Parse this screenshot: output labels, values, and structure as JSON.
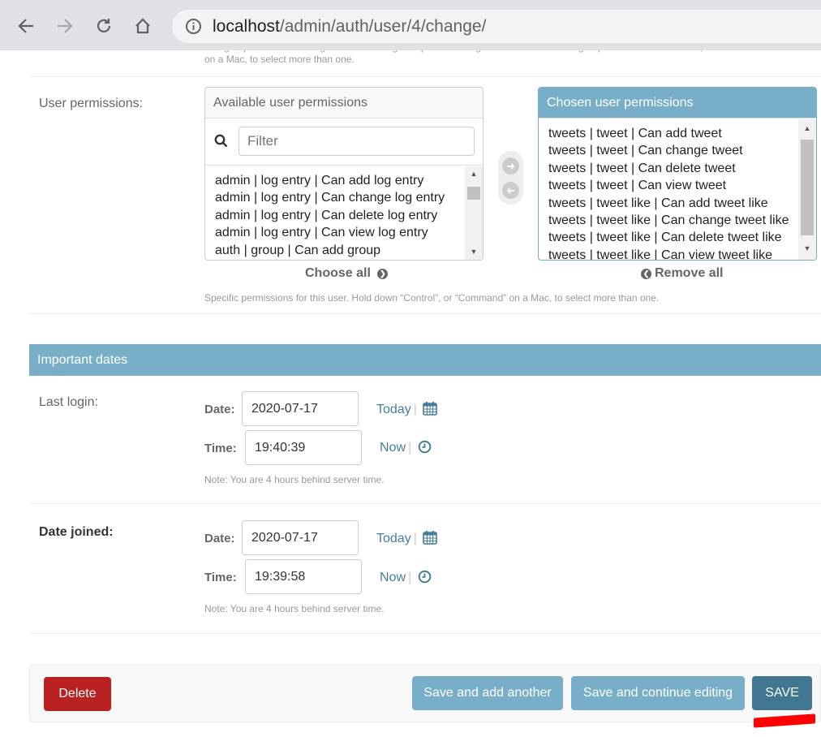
{
  "browser": {
    "url_host": "localhost",
    "url_path": "/admin/auth/user/4/change/"
  },
  "groups_help": "The groups this user belongs to. A user will get all permissions granted to each of their groups. Hold down “Control”, or “Command” on a Mac, to select more than one.",
  "permissions": {
    "label": "User permissions:",
    "available_title": "Available user permissions",
    "filter_placeholder": "Filter",
    "available_items": [
      "admin | log entry | Can add log entry",
      "admin | log entry | Can change log entry",
      "admin | log entry | Can delete log entry",
      "admin | log entry | Can view log entry",
      "auth | group | Can add group"
    ],
    "chosen_title": "Chosen user permissions",
    "chosen_items": [
      "tweets | tweet | Can add tweet",
      "tweets | tweet | Can change tweet",
      "tweets | tweet | Can delete tweet",
      "tweets | tweet | Can view tweet",
      "tweets | tweet like | Can add tweet like",
      "tweets | tweet like | Can change tweet like",
      "tweets | tweet like | Can delete tweet like",
      "tweets | tweet like | Can view tweet like"
    ],
    "choose_all": "Choose all",
    "remove_all": "Remove all",
    "help": "Specific permissions for this user. Hold down “Control”, or “Command” on a Mac, to select more than one."
  },
  "important_dates": {
    "title": "Important dates",
    "last_login": {
      "label": "Last login:",
      "date_label": "Date:",
      "date_value": "2020-07-17",
      "today": "Today",
      "time_label": "Time:",
      "time_value": "19:40:39",
      "now": "Now",
      "note": "Note: You are 4 hours behind server time."
    },
    "date_joined": {
      "label": "Date joined:",
      "date_label": "Date:",
      "date_value": "2020-07-17",
      "today": "Today",
      "time_label": "Time:",
      "time_value": "19:39:58",
      "now": "Now",
      "note": "Note: You are 4 hours behind server time."
    }
  },
  "submit": {
    "delete": "Delete",
    "save_add": "Save and add another",
    "save_continue": "Save and continue editing",
    "save": "SAVE"
  },
  "colors": {
    "module_header": "#79aec8",
    "link": "#447e9b",
    "delete": "#ba2121",
    "save": "#417690",
    "annotation_mark": "#ff0000"
  }
}
